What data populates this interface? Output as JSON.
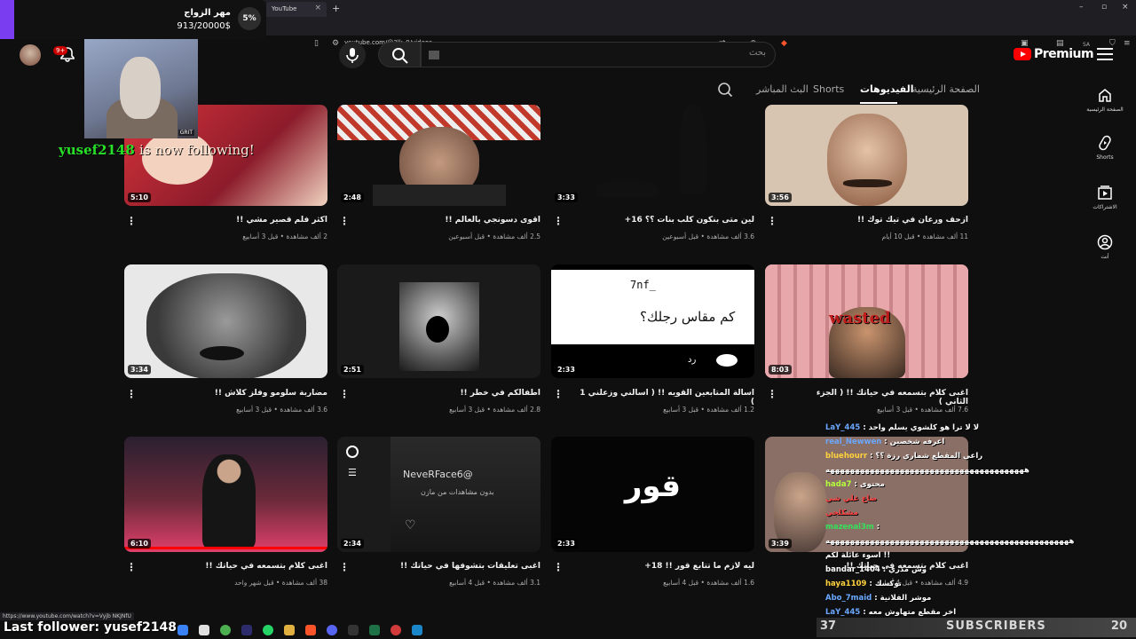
{
  "browser": {
    "tab_title": "YouTube",
    "url": "youtube.com/@3lk_9/videos",
    "status_url": "https://www.youtube.com/watch?v=Vyjb NKJNfU"
  },
  "overlay": {
    "donation_title": "مهر الزواج",
    "donation_amount": "913/20000$",
    "donation_percent": "5%",
    "webcam_tag": "GRIT",
    "follow_user": "yusef2148",
    "follow_text": "is now following!",
    "last_follower": "Last follower: yusef2148",
    "subs_count_left": "37",
    "subs_label": "SUBSCRIBERS",
    "subs_count_right": "20"
  },
  "header": {
    "logo_text": "Premium",
    "country_code": "SA",
    "search_placeholder": "بحث",
    "notification_badge": "9+"
  },
  "channel_tabs": {
    "home": "الصفحة الرئيسية",
    "videos": "الفيديوهات",
    "shorts": "Shorts",
    "live": "البث المباشر"
  },
  "sidebar": {
    "home": "الصفحة الرئيسية",
    "shorts": "Shorts",
    "subscriptions": "الاشتراكات",
    "you": "أنت"
  },
  "videos": [
    {
      "title": "ازحف ورعان في تيك توك !!",
      "meta": "11 ألف مشاهدة • قبل 10 أيام",
      "duration": "3:56",
      "bg": "#d7c5b2"
    },
    {
      "title": "لين متى بنكون كلب بنات ؟؟ 16+",
      "meta": "3.6 ألف مشاهدة • قبل أسبوعين",
      "duration": "3:33",
      "bg": "#f4f4f4"
    },
    {
      "title": "اقوى دسونجي بالعالم !!",
      "meta": "2.5 ألف مشاهدة • قبل أسبوعين",
      "duration": "2:48",
      "bg": "#9a7f6f"
    },
    {
      "title": "اكثر فلم قصير مشي !!",
      "meta": "2 ألف مشاهدة • قبل 3 أسابيع",
      "duration": "5:10",
      "bg": "#c2354a"
    },
    {
      "title": "اغبى كلام بتسمعه في حياتك !! ( الجزء الثاني )",
      "meta": "7.6 ألف مشاهدة • قبل 3 أسابيع",
      "duration": "8:03",
      "bg": "#e3a4a8"
    },
    {
      "title": "اسالة المتابعين القويه !! ( اسالني وزعلني 1 )",
      "meta": "1.2 ألف مشاهدة • قبل 3 أسابيع",
      "duration": "2:33",
      "bg": "#ffffff"
    },
    {
      "title": "اطفالكم في خطر !!",
      "meta": "2.8 ألف مشاهدة • قبل 3 أسابيع",
      "duration": "2:51",
      "bg": "#3a3a3a"
    },
    {
      "title": "مضاربة سلومو وفلز كلاش !!",
      "meta": "3.6 ألف مشاهدة • قبل 3 أسابيع",
      "duration": "3:34",
      "bg": "#d5d5d5"
    },
    {
      "title": "اغبى كلام بتسمعه في حياتك !!",
      "meta": "4.9 ألف مشاهدة • قبل 4 أسابيع",
      "duration": "3:39",
      "bg": "#8a6f66"
    },
    {
      "title": "ليه لازم ما تتابع قور !! 18+",
      "meta": "1.6 ألف مشاهدة • قبل 4 أسابيع",
      "duration": "2:33",
      "bg": "#050505"
    },
    {
      "title": "اغبى تعليقات بتشوفها في حياتك !!",
      "meta": "3.1 ألف مشاهدة • قبل 4 أسابيع",
      "duration": "2:34",
      "bg": "#1b1b1b"
    },
    {
      "title": "اغبى كلام بتسمعه في حياتك !!",
      "meta": "38 ألف مشاهدة • قبل شهر واحد",
      "duration": "6:10",
      "bg": "#6b2a3a"
    }
  ],
  "thumb_text": {
    "card6_top": "7nf_",
    "card6_q": "كم مقاس رجلك؟",
    "card6_reply": "رد",
    "card5_wasted": "wasted",
    "card10_word": "قور",
    "card11_channel": "NeveRFace6@",
    "card11_sub": "بدون مشاهدات من مازن"
  },
  "chat": [
    {
      "user": "LaY_445",
      "text": "لا لا ترا هو كلشوي يسلم واحد",
      "color": "#6aa8ff"
    },
    {
      "user": "real_Newwen",
      "text": "اعرفه شخصين",
      "color": "#6aa8ff"
    },
    {
      "user": "bluehourr",
      "text": "راعي المقطع شماري رزة ؟؟",
      "color": "#ffd23c"
    },
    {
      "user": "",
      "text": "ههههههههههههههههههههههههههههههههههههههههه",
      "color": "#ffffff"
    },
    {
      "user": "hada7",
      "text": "محتوى",
      "color": "#b5ff3c"
    },
    {
      "user": "",
      "text": "ضاع علي شي",
      "color": "#ff4444"
    },
    {
      "user": "",
      "text": "مشكلجي",
      "color": "#ff4444"
    },
    {
      "user": "mazenal3m",
      "text": "",
      "color": "#35e05a"
    },
    {
      "user": "",
      "text": "هههههههههههههههههههههههههههههههههههههههههههههههههه",
      "color": "#ffffff"
    },
    {
      "user": "",
      "text": "اسوء عائلة لكم !!",
      "color": "#ffffff"
    },
    {
      "user": "bandar_1404",
      "text": "وش مدري",
      "color": "#ffffff"
    },
    {
      "user": "haya1109",
      "text": "توكسك",
      "color": "#ffd23c"
    },
    {
      "user": "Abo_7maid",
      "text": "موشر الفلانية",
      "color": "#6aa8ff"
    },
    {
      "user": "LaY_445",
      "text": "اخر مقطع متهاوش معه",
      "color": "#6aa8ff"
    }
  ]
}
